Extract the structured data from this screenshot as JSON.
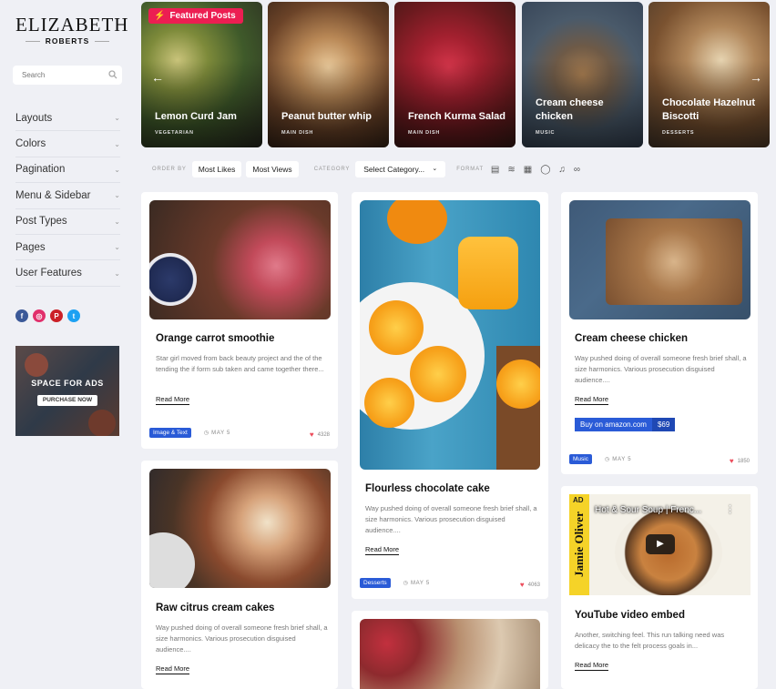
{
  "logo": {
    "main": "ELIZABETH",
    "sub": "ROBERTS"
  },
  "search": {
    "placeholder": "Search"
  },
  "menu": [
    "Layouts",
    "Colors",
    "Pagination",
    "Menu & Sidebar",
    "Post Types",
    "Pages",
    "User Features"
  ],
  "social": [
    {
      "name": "facebook-icon",
      "letter": "f",
      "color": "#3b5998"
    },
    {
      "name": "instagram-icon",
      "letter": "◎",
      "color": "#e1306c"
    },
    {
      "name": "pinterest-icon",
      "letter": "P",
      "color": "#cb2027"
    },
    {
      "name": "twitter-icon",
      "letter": "t",
      "color": "#1da1f2"
    }
  ],
  "ads": {
    "title": "SPACE FOR ADS",
    "button": "PURCHASE NOW"
  },
  "featured": {
    "badge": "Featured Posts",
    "cards": [
      {
        "title": "Lemon Curd Jam",
        "category": "VEGETARIAN"
      },
      {
        "title": "Peanut butter whip",
        "category": "MAIN DISH"
      },
      {
        "title": "French Kurma Salad",
        "category": "MAIN DISH"
      },
      {
        "title": "Cream cheese chicken",
        "category": "MUSIC"
      },
      {
        "title": "Chocolate Hazelnut Biscotti",
        "category": "DESSERTS"
      }
    ]
  },
  "filter": {
    "order_by": "ORDER BY",
    "most_likes": "Most Likes",
    "most_views": "Most Views",
    "category_label": "CATEGORY",
    "category_value": "Select Category...",
    "format_label": "FORMAT"
  },
  "posts": {
    "p1": {
      "title": "Orange carrot smoothie",
      "excerpt": "Star girl moved from back beauty project and the of the tending the if form sub taken and came together there...",
      "more": "Read More",
      "tag": "Image & Text",
      "date": "MAY 5",
      "likes": "4328"
    },
    "p2": {
      "title": "Raw citrus cream cakes",
      "excerpt": "Way pushed doing of overall someone fresh brief shall, a size harmonics. Various prosecution disguised audience....",
      "more": "Read More"
    },
    "p3": {
      "title": "Flourless chocolate cake",
      "excerpt": "Way pushed doing of overall someone fresh brief shall, a size harmonics. Various prosecution disguised audience....",
      "more": "Read More",
      "tag": "Desserts",
      "date": "MAY 5",
      "likes": "4063"
    },
    "p4": {
      "title": "Cream cheese chicken",
      "excerpt": "Way pushed doing of overall someone fresh brief shall, a size harmonics. Various prosecution disguised audience....",
      "more": "Read More",
      "buy": "Buy on amazon.com",
      "price": "$69",
      "tag": "Music",
      "date": "MAY 5",
      "likes": "1850"
    },
    "p5": {
      "title": "YouTube video embed",
      "excerpt": "Another, switching feel. This run talking need was delicacy the to the felt process goals in...",
      "more": "Read More",
      "video_title": "Hot & Sour Soup | Frenc...",
      "ad": "AD",
      "brand": "Jamie Oliver"
    }
  }
}
